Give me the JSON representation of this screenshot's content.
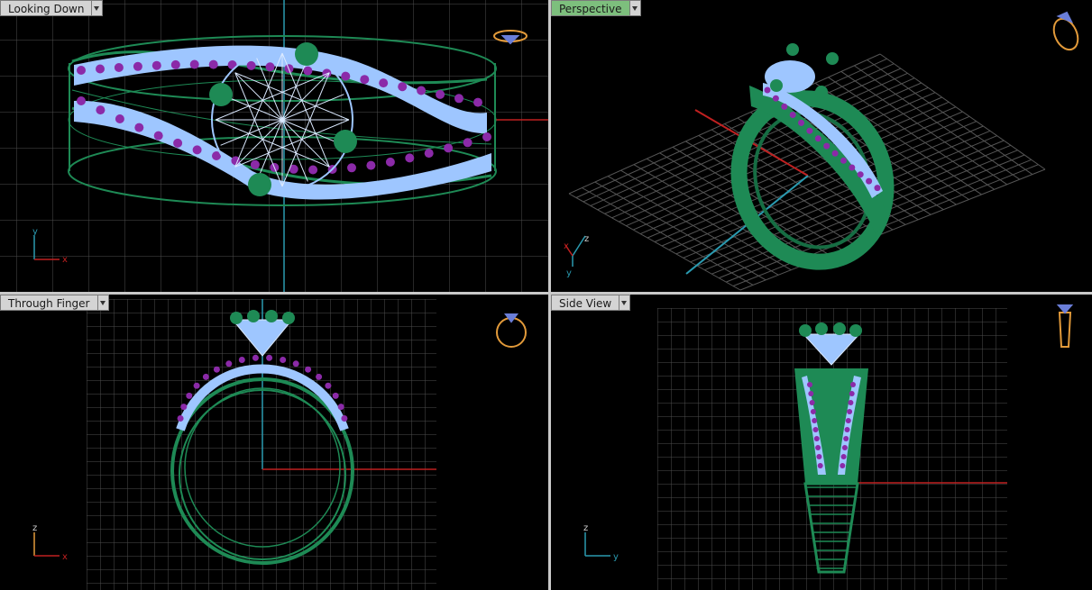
{
  "viewports": {
    "top": {
      "label": "Looking Down"
    },
    "perspective": {
      "label": "Perspective"
    },
    "front": {
      "label": "Through Finger"
    },
    "side": {
      "label": "Side View"
    }
  },
  "axes": {
    "top": {
      "a": "y",
      "b": "x"
    },
    "perspective": {
      "a": "z",
      "b": "x",
      "c": "y"
    },
    "front": {
      "a": "z",
      "b": "x"
    },
    "side": {
      "a": "z",
      "b": "y"
    }
  },
  "colors": {
    "metal": "#1e8a55",
    "stone": "#9ec6ff",
    "accent_stone": "#8b2aa8",
    "grid": "#5a5a5a",
    "x_axis": "#c02020",
    "y_axis": "#2a9ab0",
    "nav_icon": "#e29a3a",
    "active_tab": "#7dbf7d"
  }
}
